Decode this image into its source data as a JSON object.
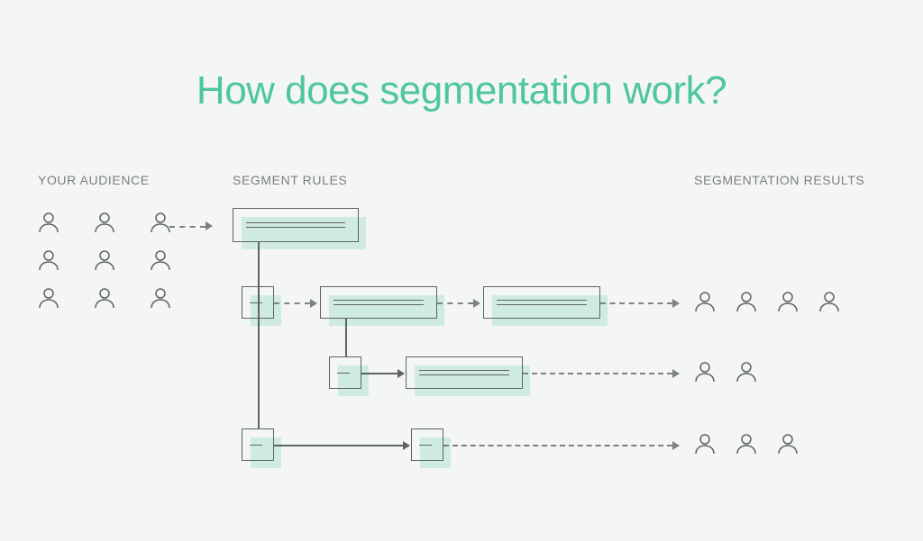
{
  "title": "How does segmentation work?",
  "labels": {
    "audience": "YOUR AUDIENCE",
    "rules": "SEGMENT RULES",
    "results": "SEGMENTATION RESULTS"
  },
  "audience_people_count": 9,
  "result_rows": [
    4,
    2,
    3
  ]
}
